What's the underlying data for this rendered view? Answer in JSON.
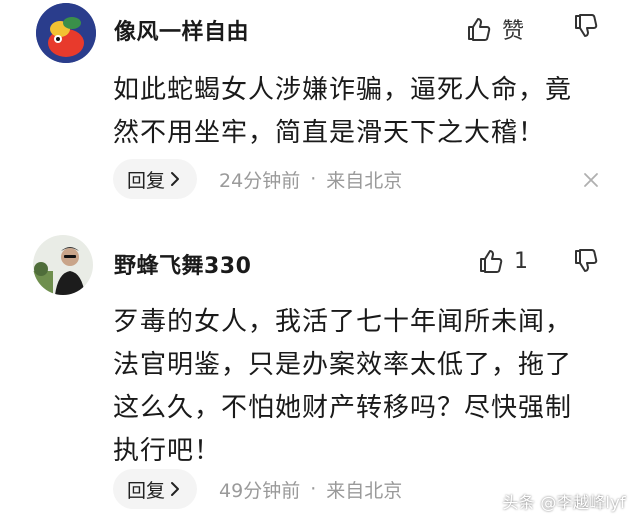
{
  "comments": [
    {
      "username": "像风一样自由",
      "like_label": "赞",
      "body_lines": [
        "如此蛇蝎女人涉嫌诈骗，逼死人命，竟",
        "然不用坐牢，简直是滑天下之大稽！"
      ],
      "reply_label": "回复",
      "time": "24分钟前",
      "location": "来自北京"
    },
    {
      "username": "野蜂飞舞330",
      "like_label": "1",
      "body_lines": [
        "歹毒的女人，我活了七十年闻所未闻，",
        "法官明鉴，只是办案效率太低了，拖了",
        "这么久，不怕她财产转移吗？尽快强制",
        "执行吧！"
      ],
      "reply_label": "回复",
      "time": "49分钟前",
      "location": "来自北京"
    }
  ],
  "separator": "·",
  "watermark": "头条 @李越峰lyf",
  "icons": {
    "like": "thumbs-up-icon",
    "dislike": "thumbs-down-icon",
    "reply_arrow": "chevron-right-icon",
    "close": "close-icon"
  },
  "colors": {
    "text_primary": "#1a1a1a",
    "text_secondary": "#9a9a9a",
    "reply_bg": "#f4f4f4"
  }
}
